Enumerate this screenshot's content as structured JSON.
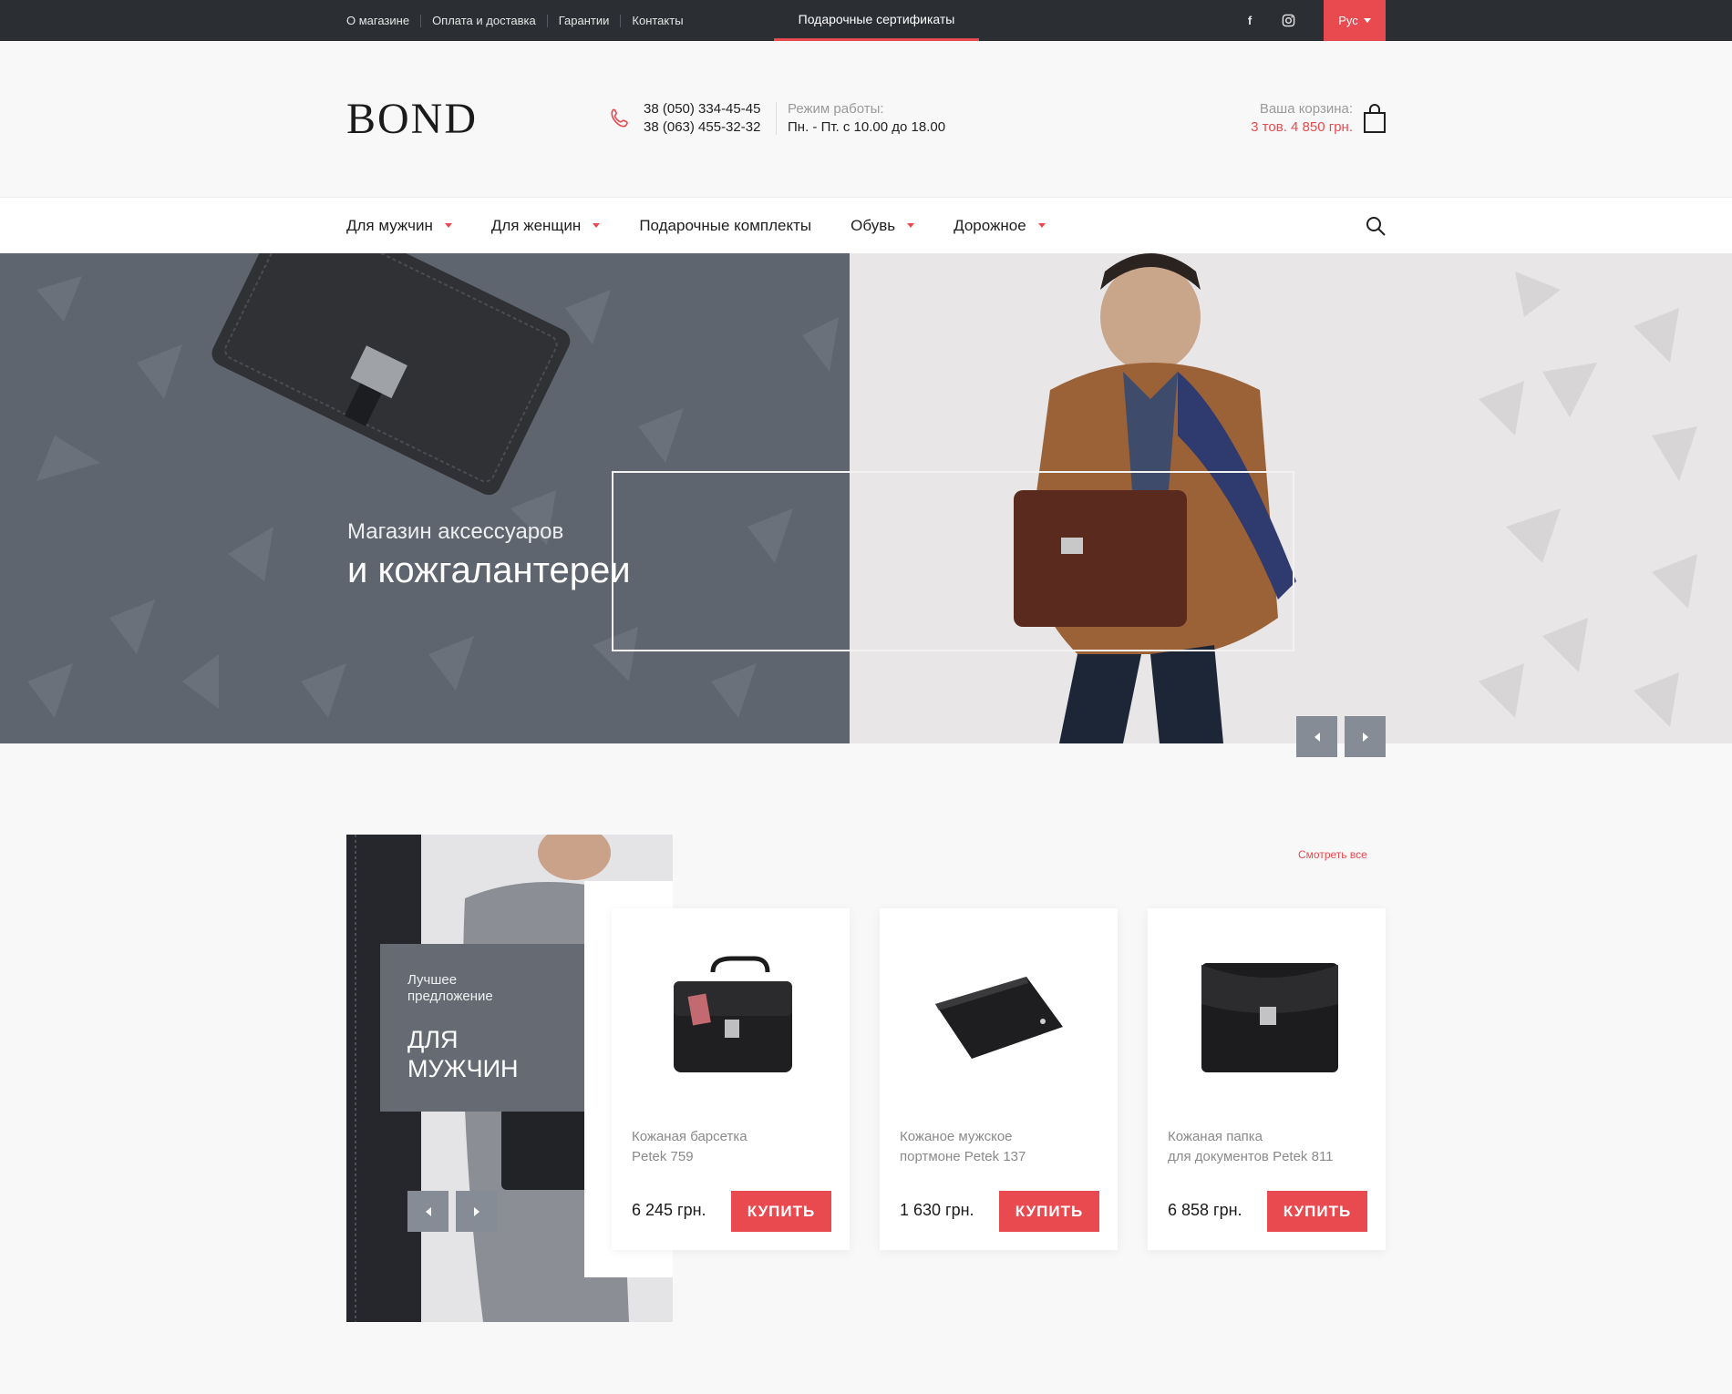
{
  "topbar": {
    "links": [
      "О магазине",
      "Оплата и доставка",
      "Гарантии",
      "Контакты"
    ],
    "gift_link": "Подарочные сертификаты",
    "social": [
      "facebook-icon",
      "instagram-icon"
    ],
    "language": "Рус"
  },
  "header": {
    "logo": "BOND",
    "phone_1": "38 (050) 334-45-45",
    "phone_2": "38 (063) 455-32-32",
    "hours_label": "Режим работы:",
    "hours_value": "Пн. - Пт. с 10.00 до 18.00",
    "cart_label": "Ваша корзина:",
    "cart_value": "3 тов. 4 850 грн."
  },
  "nav": {
    "items": [
      {
        "label": "Для мужчин",
        "dropdown": true
      },
      {
        "label": "Для женщин",
        "dropdown": true
      },
      {
        "label": "Подарочные комплекты",
        "dropdown": false
      },
      {
        "label": "Обувь",
        "dropdown": true
      },
      {
        "label": "Дорожное",
        "dropdown": true
      }
    ]
  },
  "hero": {
    "subtitle": "Магазин аксессуаров",
    "title": "и кожгалантереи"
  },
  "promo": {
    "subtitle_line1": "Лучшее",
    "subtitle_line2": "предложение",
    "title_line1": "ДЛЯ",
    "title_line2": "МУЖЧИН"
  },
  "products": {
    "see_all": "Смотреть все",
    "buy_label": "КУПИТЬ",
    "items": [
      {
        "name_line1": "Кожаная барсетка",
        "name_line2": "Petek 759",
        "price": "6 245 грн."
      },
      {
        "name_line1": "Кожаное мужское",
        "name_line2": "портмоне Petek 137",
        "price": "1 630 грн."
      },
      {
        "name_line1": "Кожаная папка",
        "name_line2": "для документов Petek 811",
        "price": "6 858 грн."
      }
    ]
  },
  "colors": {
    "accent": "#e84a4f",
    "topbar": "#2b2e33",
    "hero_left": "#5f656e",
    "slider_button": "#868c95"
  }
}
